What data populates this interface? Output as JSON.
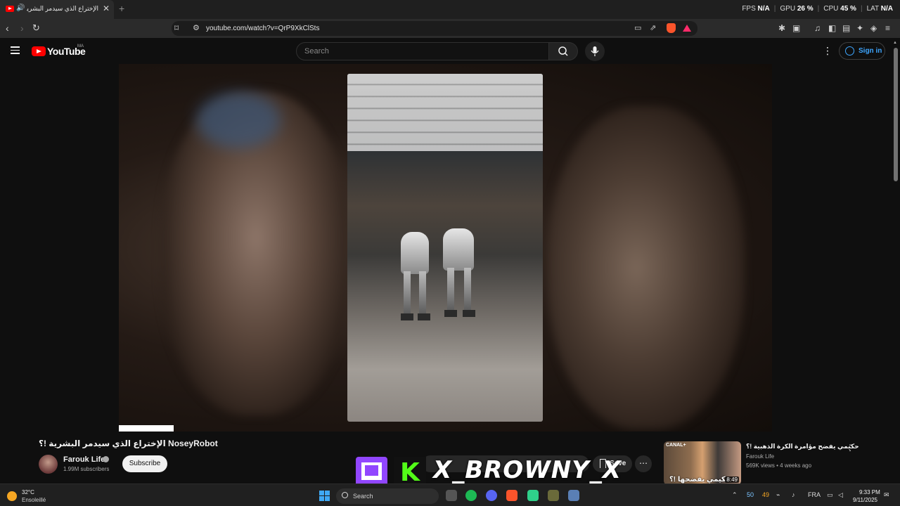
{
  "browser": {
    "tab_title": "الإختراع الذي سيدمر البشرية !؟",
    "new_tab": "+",
    "url": "youtube.com/watch?v=QrP9XkClSts",
    "perf": [
      {
        "label": "FPS",
        "value": "N/A"
      },
      {
        "label": "GPU",
        "value": "26 %"
      },
      {
        "label": "CPU",
        "value": "45 %"
      },
      {
        "label": "LAT",
        "value": "N/A"
      }
    ]
  },
  "youtube": {
    "logo_text": "YouTube",
    "region": "MA",
    "search_placeholder": "Search",
    "sign_in": "Sign in"
  },
  "video": {
    "title": "الإختراع الذي سيدمر البشرية !؟ NoseyRobot",
    "channel": "Farouk Life",
    "subscribers": "1.99M subscribers",
    "subscribe_label": "Subscribe",
    "save_label": "Save",
    "progress_fraction": 0.084
  },
  "overlay": {
    "kick_letter": "K",
    "handle": "X_BROWNY_X"
  },
  "recommendation": {
    "title": "حكيمي يفضح مؤامرة الكرة الذهبية !؟",
    "channel": "Farouk Life",
    "meta": "569K views • 4 weeks ago",
    "duration": "8:49",
    "thumb_brand": "CANAL+",
    "thumb_text": "حكيمي يفضحها !؟"
  },
  "taskbar": {
    "temp": "32°C",
    "weather": "Ensoleillé",
    "search_label": "Search",
    "tray_numbers": [
      "50",
      "49"
    ],
    "lang": "FRA",
    "time": "9:33 PM",
    "date": "9/11/2025"
  },
  "colors": {
    "youtube_red": "#ff0000",
    "link_blue": "#3ea6ff",
    "twitch_purple": "#9146ff",
    "kick_green": "#53fc18"
  }
}
